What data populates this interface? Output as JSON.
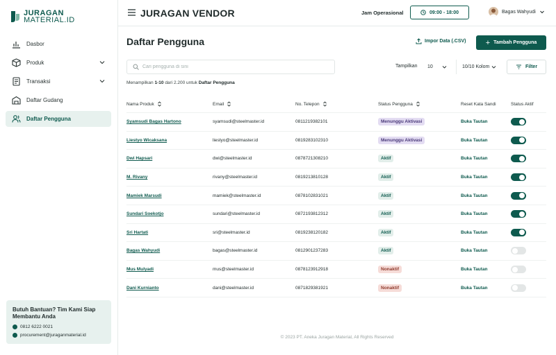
{
  "brand": {
    "line1": "JURAGAN",
    "line2": "MATERIAL.ID",
    "color": "#0e5a4e"
  },
  "sidebar": {
    "items": [
      {
        "label": "Dasbor",
        "icon": "bar-chart-icon",
        "has_chevron": false,
        "active": false
      },
      {
        "label": "Produk",
        "icon": "box-icon",
        "has_chevron": true,
        "active": false
      },
      {
        "label": "Transaksi",
        "icon": "receipt-icon",
        "has_chevron": true,
        "active": false
      },
      {
        "label": "Daftar Gudang",
        "icon": "warehouse-icon",
        "has_chevron": false,
        "active": false
      },
      {
        "label": "Daftar Pengguna",
        "icon": "users-icon",
        "has_chevron": false,
        "active": true
      }
    ],
    "help": {
      "title": "Butuh Bantuan? Tim Kami Siap Membantu Anda",
      "phone": "0812 6222 0021",
      "email": "procurement@juraganmaterial.id"
    }
  },
  "header": {
    "title": "JURAGAN VENDOR",
    "jam_label": "Jam Operasional",
    "jam_value": "09:00 - 18:00",
    "user_name": "Bagas Wahyudi"
  },
  "main": {
    "title": "Daftar Pengguna",
    "import_label": "Impor Data (.CSV)",
    "add_label": "Tambah Pengguna",
    "search_placeholder": "Cari pengguna di sini",
    "show_label": "Tampilkan",
    "show_value": "10",
    "columns_value": "10/10 Kolom",
    "filter_label": "Filter",
    "summary_prefix": "Menampilkan",
    "summary_range": "1-10",
    "summary_mid": "dari 2.200 untuk",
    "summary_target": "Daftar Pengguna"
  },
  "table": {
    "headers": [
      "Nama Produk",
      "Email",
      "No. Telepon",
      "Status Pengguna",
      "Reset Kata Sandi",
      "Status Aktif"
    ],
    "rows": [
      {
        "name": "Syamsudi Bagas Hartono",
        "email": "syamsudi@steelmaster.id",
        "phone": "0811219382101",
        "status": "Menunggu Aktivasi",
        "status_type": "wait",
        "reset": "Buka Tautan",
        "active": true
      },
      {
        "name": "Liestyo Wicaksana",
        "email": "liestyo@steelmaster.id",
        "phone": "0819283102310",
        "status": "Menunggu Aktivasi",
        "status_type": "wait",
        "reset": "Buka Tautan",
        "active": true
      },
      {
        "name": "Dwi Hapsari",
        "email": "dwi@steelmaster.id",
        "phone": "0878721308210",
        "status": "Aktif",
        "status_type": "active",
        "reset": "Buka Tautan",
        "active": true
      },
      {
        "name": "M. Rivany",
        "email": "rivany@steelmaster.id",
        "phone": "0819213810128",
        "status": "Aktif",
        "status_type": "active",
        "reset": "Buka Tautan",
        "active": true
      },
      {
        "name": "Mamiek Marsudi",
        "email": "mamiek@steelmaster.id",
        "phone": "0878102831021",
        "status": "Aktif",
        "status_type": "active",
        "reset": "Buka Tautan",
        "active": true
      },
      {
        "name": "Sundari Soekotjo",
        "email": "sundari@steelmaster.id",
        "phone": "0872193812312",
        "status": "Aktif",
        "status_type": "active",
        "reset": "Buka Tautan",
        "active": true
      },
      {
        "name": "Sri Hartati",
        "email": "sri@steelmaster.id",
        "phone": "0819238120182",
        "status": "Aktif",
        "status_type": "active",
        "reset": "Buka Tautan",
        "active": true
      },
      {
        "name": "Bagas Wahyudi",
        "email": "bagas@steelmaster.id",
        "phone": "0812901237283",
        "status": "Aktif",
        "status_type": "active",
        "reset": "Buka Tautan",
        "active": false
      },
      {
        "name": "Mus Mulyadi",
        "email": "mus@steelmaster.id",
        "phone": "0878123912918",
        "status": "Nonaktif",
        "status_type": "inactive",
        "reset": "Buka Tautan",
        "active": false
      },
      {
        "name": "Dani Kurnianto",
        "email": "dani@steelmaster.id",
        "phone": "0871829381921",
        "status": "Nonaktif",
        "status_type": "inactive",
        "reset": "Buka Tautan",
        "active": false
      }
    ]
  },
  "footer": {
    "text": "© 2023 PT. Aneka Juragan Material, All Rights Reserved"
  }
}
